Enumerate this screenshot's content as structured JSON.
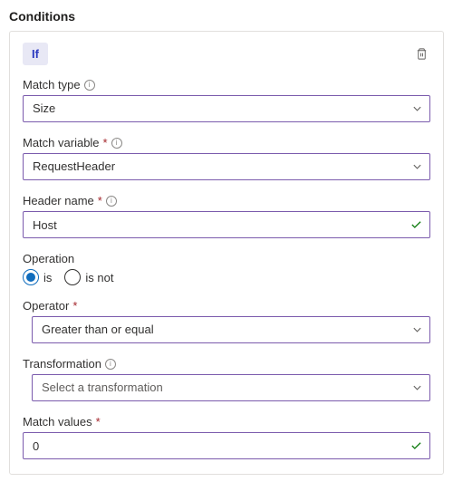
{
  "section": {
    "title": "Conditions"
  },
  "header": {
    "chip": "If"
  },
  "fields": {
    "matchType": {
      "label": "Match type",
      "value": "Size",
      "required": false,
      "hasInfo": true
    },
    "matchVariable": {
      "label": "Match variable",
      "value": "RequestHeader",
      "required": true,
      "hasInfo": true
    },
    "headerName": {
      "label": "Header name",
      "value": "Host",
      "required": true,
      "hasInfo": true
    },
    "operation": {
      "label": "Operation",
      "value": "is",
      "options": {
        "is": "is",
        "isNot": "is not"
      }
    },
    "operator": {
      "label": "Operator",
      "value": "Greater than or equal",
      "required": true
    },
    "transformation": {
      "label": "Transformation",
      "placeholder": "Select a transformation",
      "hasInfo": true
    },
    "matchValues": {
      "label": "Match values",
      "value": "0",
      "required": true
    }
  }
}
